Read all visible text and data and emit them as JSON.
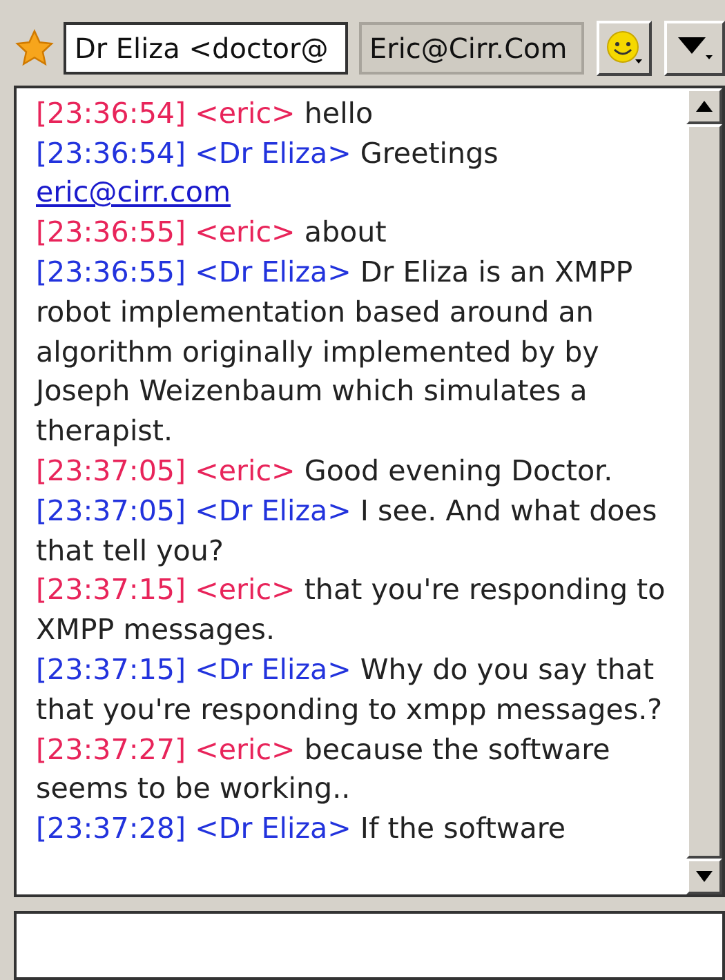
{
  "header": {
    "contact": "Dr Eliza <doctor@",
    "account": "Eric@Cirr.Com"
  },
  "messages": [
    {
      "time": "[23:36:54]",
      "nick": "<eric>",
      "text": "hello",
      "color": "#e8245a"
    },
    {
      "time": "[23:36:54]",
      "nick": "<Dr Eliza>",
      "text": "Greetings",
      "link": "eric@cirr.com",
      "color": "#2233dd"
    },
    {
      "time": "[23:36:55]",
      "nick": "<eric>",
      "text": "about",
      "color": "#e8245a"
    },
    {
      "time": "[23:36:55]",
      "nick": "<Dr Eliza>",
      "text": "Dr Eliza is an XMPP robot implementation based around an algorithm originally implemented by by Joseph Weizenbaum which simulates a therapist.",
      "color": "#2233dd"
    },
    {
      "time": "[23:37:05]",
      "nick": "<eric>",
      "text": "Good evening Doctor.",
      "color": "#e8245a"
    },
    {
      "time": "[23:37:05]",
      "nick": "<Dr Eliza>",
      "text": "I see.  And what does that tell you?",
      "color": "#2233dd"
    },
    {
      "time": "[23:37:15]",
      "nick": "<eric>",
      "text": "that you're responding to XMPP messages.",
      "color": "#e8245a"
    },
    {
      "time": "[23:37:15]",
      "nick": "<Dr Eliza>",
      "text": "Why do you say that that you're responding to xmpp messages.?",
      "color": "#2233dd"
    },
    {
      "time": "[23:37:27]",
      "nick": "<eric>",
      "text": "because the software seems to be working..",
      "color": "#e8245a"
    },
    {
      "time": "[23:37:28]",
      "nick": "<Dr Eliza>",
      "text": "If the software",
      "color": "#2233dd"
    }
  ]
}
